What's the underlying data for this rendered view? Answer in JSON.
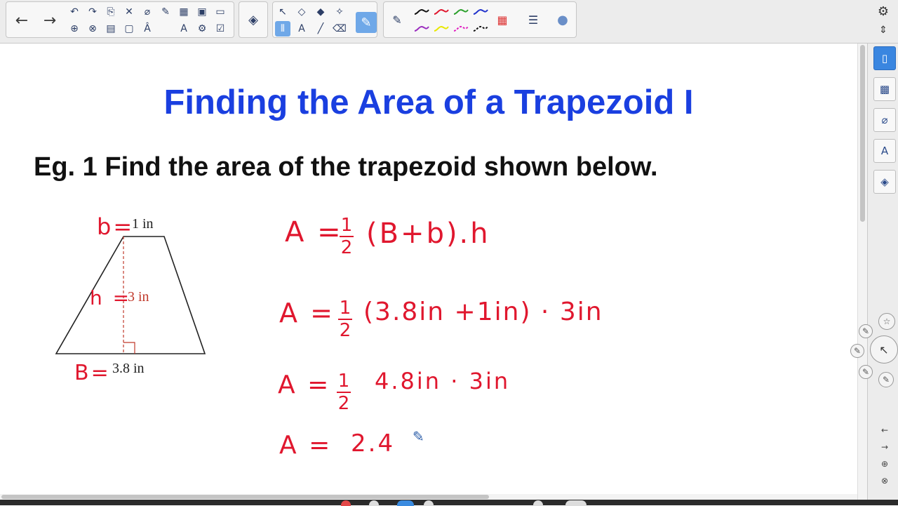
{
  "toolbar": {
    "nav": {
      "back": "←",
      "forward": "→"
    },
    "icons_row1": [
      {
        "name": "undo-icon",
        "glyph": "↶"
      },
      {
        "name": "redo-icon",
        "glyph": "↷"
      },
      {
        "name": "paste-icon",
        "glyph": "⎘"
      },
      {
        "name": "delete-icon",
        "glyph": "✕"
      },
      {
        "name": "attach-icon",
        "glyph": "⌀"
      },
      {
        "name": "eraser-line-icon",
        "glyph": "✎"
      },
      {
        "name": "table-icon",
        "glyph": "▦"
      },
      {
        "name": "screen-capture-icon",
        "glyph": "▣"
      },
      {
        "name": "screen-shade-icon",
        "glyph": "▭"
      }
    ],
    "icons_row2": [
      {
        "name": "new-page-icon",
        "glyph": "⊕"
      },
      {
        "name": "delete-page-icon",
        "glyph": "⊗"
      },
      {
        "name": "save-icon",
        "glyph": "▤"
      },
      {
        "name": "display-icon",
        "glyph": "▢"
      },
      {
        "name": "text-style-icon",
        "glyph": "Â"
      },
      {
        "name": "font-icon",
        "glyph": "A"
      },
      {
        "name": "widgets-icon",
        "glyph": "⚙"
      },
      {
        "name": "check-icon",
        "glyph": "☑"
      }
    ],
    "tools": [
      {
        "name": "select-arrow-icon",
        "glyph": "↖",
        "selected": false
      },
      {
        "name": "shapes-icon",
        "glyph": "◇",
        "selected": false
      },
      {
        "name": "fill-icon",
        "glyph": "◆",
        "selected": false
      },
      {
        "name": "magic-pen-icon",
        "glyph": "✧",
        "selected": false
      },
      {
        "name": "pen-tool-icon",
        "glyph": "✎",
        "selected": true
      },
      {
        "name": "measure-icon",
        "glyph": "⫴",
        "selected": true
      },
      {
        "name": "text-tool-icon",
        "glyph": "A",
        "selected": false
      },
      {
        "name": "line-tool-icon",
        "glyph": "╱",
        "selected": false
      },
      {
        "name": "eraser-icon",
        "glyph": "⌫",
        "selected": false
      }
    ],
    "pen_colors": [
      "#111111",
      "#e0172e",
      "#2ca02c",
      "#2233cc",
      "#9b2fbf",
      "#e8e800",
      "#e020c0",
      "#111111"
    ],
    "palette": "color-palette-icon",
    "line_style": "line-style-icon",
    "fill_effect": "fill-effect-icon"
  },
  "slide": {
    "title": "Finding the Area of a Trapezoid I",
    "question": "Eg. 1 Find the area of the trapezoid shown below.",
    "figure": {
      "top_base": "1 in",
      "height": "3 in",
      "bottom_base": "3.8 in",
      "label_b": "b=",
      "label_h": "h =",
      "label_B": "B="
    },
    "work": {
      "line1": {
        "lhs": "A =",
        "num": "1",
        "den": "2",
        "rest": "(B+b).h"
      },
      "line2": {
        "lhs": "A =",
        "num": "1",
        "den": "2",
        "rest": "(3.8in +1in) · 3in"
      },
      "line3": {
        "lhs": "A =",
        "num": "1",
        "den": "2",
        "rest": "4.8in  · 3in"
      },
      "line4": {
        "lhs": "A =",
        "rest": "2.4"
      }
    }
  },
  "side_panel": {
    "settings": "⚙",
    "move": "⇕",
    "tabs": [
      {
        "name": "tab-page-sorter",
        "glyph": "▯"
      },
      {
        "name": "tab-gallery",
        "glyph": "▩"
      },
      {
        "name": "tab-attachments",
        "glyph": "⌀"
      },
      {
        "name": "tab-properties",
        "glyph": "A"
      },
      {
        "name": "tab-addons",
        "glyph": "◈"
      }
    ],
    "small_nav": [
      "←",
      "→",
      "⊕",
      "⊗"
    ]
  },
  "colors": {
    "title": "#1a3fe0",
    "ink_red": "#e0172e",
    "selected_tool": "#6fa8e8"
  }
}
